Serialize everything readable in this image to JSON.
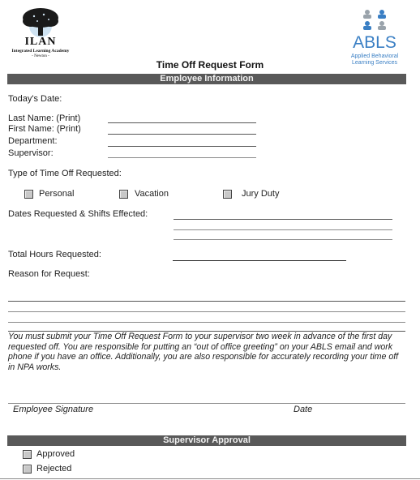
{
  "logos": {
    "left": {
      "name": "ILAN",
      "subtitle": "Integrated Learning Academy",
      "location": "- Newton -"
    },
    "right": {
      "name": "ABLS",
      "subtitle_line1": "Applied Behavioral",
      "subtitle_line2": "Learning Services"
    }
  },
  "form": {
    "title": "Time Off Request Form",
    "sections": {
      "employee_info": "Employee Information",
      "supervisor_approval": "Supervisor Approval"
    },
    "fields": {
      "todays_date": "Today's Date:",
      "last_name": "Last Name: (Print)",
      "first_name": "First Name: (Print)",
      "department": "Department:",
      "supervisor": "Supervisor:",
      "type_of_time_off": "Type of Time Off Requested:",
      "dates_requested": "Dates Requested & Shifts Effected:",
      "total_hours": "Total Hours Requested:",
      "reason": "Reason for Request:"
    },
    "time_off_types": [
      {
        "label": "Personal",
        "checked": false
      },
      {
        "label": "Vacation",
        "checked": false
      },
      {
        "label": "Jury Duty",
        "checked": false
      }
    ],
    "notice": "You must submit your Time Off Request Form to your supervisor two week in advance of the first day requested off. You are responsible for putting an “out of office greeting” on your ABLS email and work phone if you have an office. Additionally, you are also responsible for accurately recording your time off in NPA works.",
    "signature": {
      "employee_signature": "Employee Signature",
      "date": "Date"
    },
    "approval_options": [
      {
        "label": "Approved",
        "checked": false
      },
      {
        "label": "Rejected",
        "checked": false
      }
    ]
  },
  "colors": {
    "section_bar": "#595959",
    "section_text": "#f2f2f2",
    "abls_blue": "#3a7fc4",
    "abls_gray": "#9aa3ab"
  }
}
